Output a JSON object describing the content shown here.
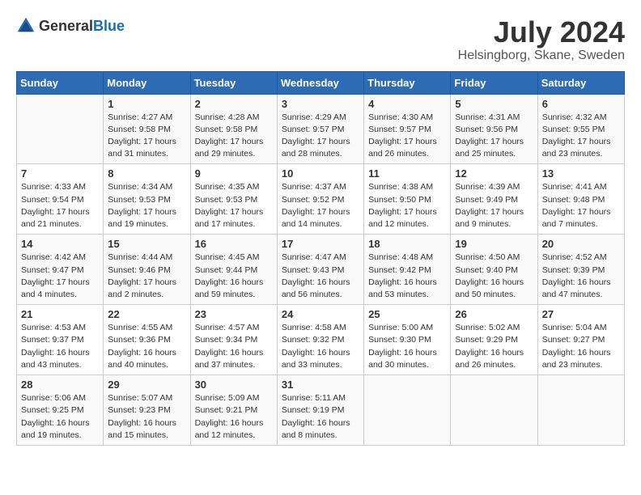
{
  "header": {
    "logo_general": "General",
    "logo_blue": "Blue",
    "month_year": "July 2024",
    "location": "Helsingborg, Skane, Sweden"
  },
  "days_of_week": [
    "Sunday",
    "Monday",
    "Tuesday",
    "Wednesday",
    "Thursday",
    "Friday",
    "Saturday"
  ],
  "weeks": [
    [
      {
        "day": "",
        "info": ""
      },
      {
        "day": "1",
        "info": "Sunrise: 4:27 AM\nSunset: 9:58 PM\nDaylight: 17 hours\nand 31 minutes."
      },
      {
        "day": "2",
        "info": "Sunrise: 4:28 AM\nSunset: 9:58 PM\nDaylight: 17 hours\nand 29 minutes."
      },
      {
        "day": "3",
        "info": "Sunrise: 4:29 AM\nSunset: 9:57 PM\nDaylight: 17 hours\nand 28 minutes."
      },
      {
        "day": "4",
        "info": "Sunrise: 4:30 AM\nSunset: 9:57 PM\nDaylight: 17 hours\nand 26 minutes."
      },
      {
        "day": "5",
        "info": "Sunrise: 4:31 AM\nSunset: 9:56 PM\nDaylight: 17 hours\nand 25 minutes."
      },
      {
        "day": "6",
        "info": "Sunrise: 4:32 AM\nSunset: 9:55 PM\nDaylight: 17 hours\nand 23 minutes."
      }
    ],
    [
      {
        "day": "7",
        "info": "Sunrise: 4:33 AM\nSunset: 9:54 PM\nDaylight: 17 hours\nand 21 minutes."
      },
      {
        "day": "8",
        "info": "Sunrise: 4:34 AM\nSunset: 9:53 PM\nDaylight: 17 hours\nand 19 minutes."
      },
      {
        "day": "9",
        "info": "Sunrise: 4:35 AM\nSunset: 9:53 PM\nDaylight: 17 hours\nand 17 minutes."
      },
      {
        "day": "10",
        "info": "Sunrise: 4:37 AM\nSunset: 9:52 PM\nDaylight: 17 hours\nand 14 minutes."
      },
      {
        "day": "11",
        "info": "Sunrise: 4:38 AM\nSunset: 9:50 PM\nDaylight: 17 hours\nand 12 minutes."
      },
      {
        "day": "12",
        "info": "Sunrise: 4:39 AM\nSunset: 9:49 PM\nDaylight: 17 hours\nand 9 minutes."
      },
      {
        "day": "13",
        "info": "Sunrise: 4:41 AM\nSunset: 9:48 PM\nDaylight: 17 hours\nand 7 minutes."
      }
    ],
    [
      {
        "day": "14",
        "info": "Sunrise: 4:42 AM\nSunset: 9:47 PM\nDaylight: 17 hours\nand 4 minutes."
      },
      {
        "day": "15",
        "info": "Sunrise: 4:44 AM\nSunset: 9:46 PM\nDaylight: 17 hours\nand 2 minutes."
      },
      {
        "day": "16",
        "info": "Sunrise: 4:45 AM\nSunset: 9:44 PM\nDaylight: 16 hours\nand 59 minutes."
      },
      {
        "day": "17",
        "info": "Sunrise: 4:47 AM\nSunset: 9:43 PM\nDaylight: 16 hours\nand 56 minutes."
      },
      {
        "day": "18",
        "info": "Sunrise: 4:48 AM\nSunset: 9:42 PM\nDaylight: 16 hours\nand 53 minutes."
      },
      {
        "day": "19",
        "info": "Sunrise: 4:50 AM\nSunset: 9:40 PM\nDaylight: 16 hours\nand 50 minutes."
      },
      {
        "day": "20",
        "info": "Sunrise: 4:52 AM\nSunset: 9:39 PM\nDaylight: 16 hours\nand 47 minutes."
      }
    ],
    [
      {
        "day": "21",
        "info": "Sunrise: 4:53 AM\nSunset: 9:37 PM\nDaylight: 16 hours\nand 43 minutes."
      },
      {
        "day": "22",
        "info": "Sunrise: 4:55 AM\nSunset: 9:36 PM\nDaylight: 16 hours\nand 40 minutes."
      },
      {
        "day": "23",
        "info": "Sunrise: 4:57 AM\nSunset: 9:34 PM\nDaylight: 16 hours\nand 37 minutes."
      },
      {
        "day": "24",
        "info": "Sunrise: 4:58 AM\nSunset: 9:32 PM\nDaylight: 16 hours\nand 33 minutes."
      },
      {
        "day": "25",
        "info": "Sunrise: 5:00 AM\nSunset: 9:30 PM\nDaylight: 16 hours\nand 30 minutes."
      },
      {
        "day": "26",
        "info": "Sunrise: 5:02 AM\nSunset: 9:29 PM\nDaylight: 16 hours\nand 26 minutes."
      },
      {
        "day": "27",
        "info": "Sunrise: 5:04 AM\nSunset: 9:27 PM\nDaylight: 16 hours\nand 23 minutes."
      }
    ],
    [
      {
        "day": "28",
        "info": "Sunrise: 5:06 AM\nSunset: 9:25 PM\nDaylight: 16 hours\nand 19 minutes."
      },
      {
        "day": "29",
        "info": "Sunrise: 5:07 AM\nSunset: 9:23 PM\nDaylight: 16 hours\nand 15 minutes."
      },
      {
        "day": "30",
        "info": "Sunrise: 5:09 AM\nSunset: 9:21 PM\nDaylight: 16 hours\nand 12 minutes."
      },
      {
        "day": "31",
        "info": "Sunrise: 5:11 AM\nSunset: 9:19 PM\nDaylight: 16 hours\nand 8 minutes."
      },
      {
        "day": "",
        "info": ""
      },
      {
        "day": "",
        "info": ""
      },
      {
        "day": "",
        "info": ""
      }
    ]
  ]
}
